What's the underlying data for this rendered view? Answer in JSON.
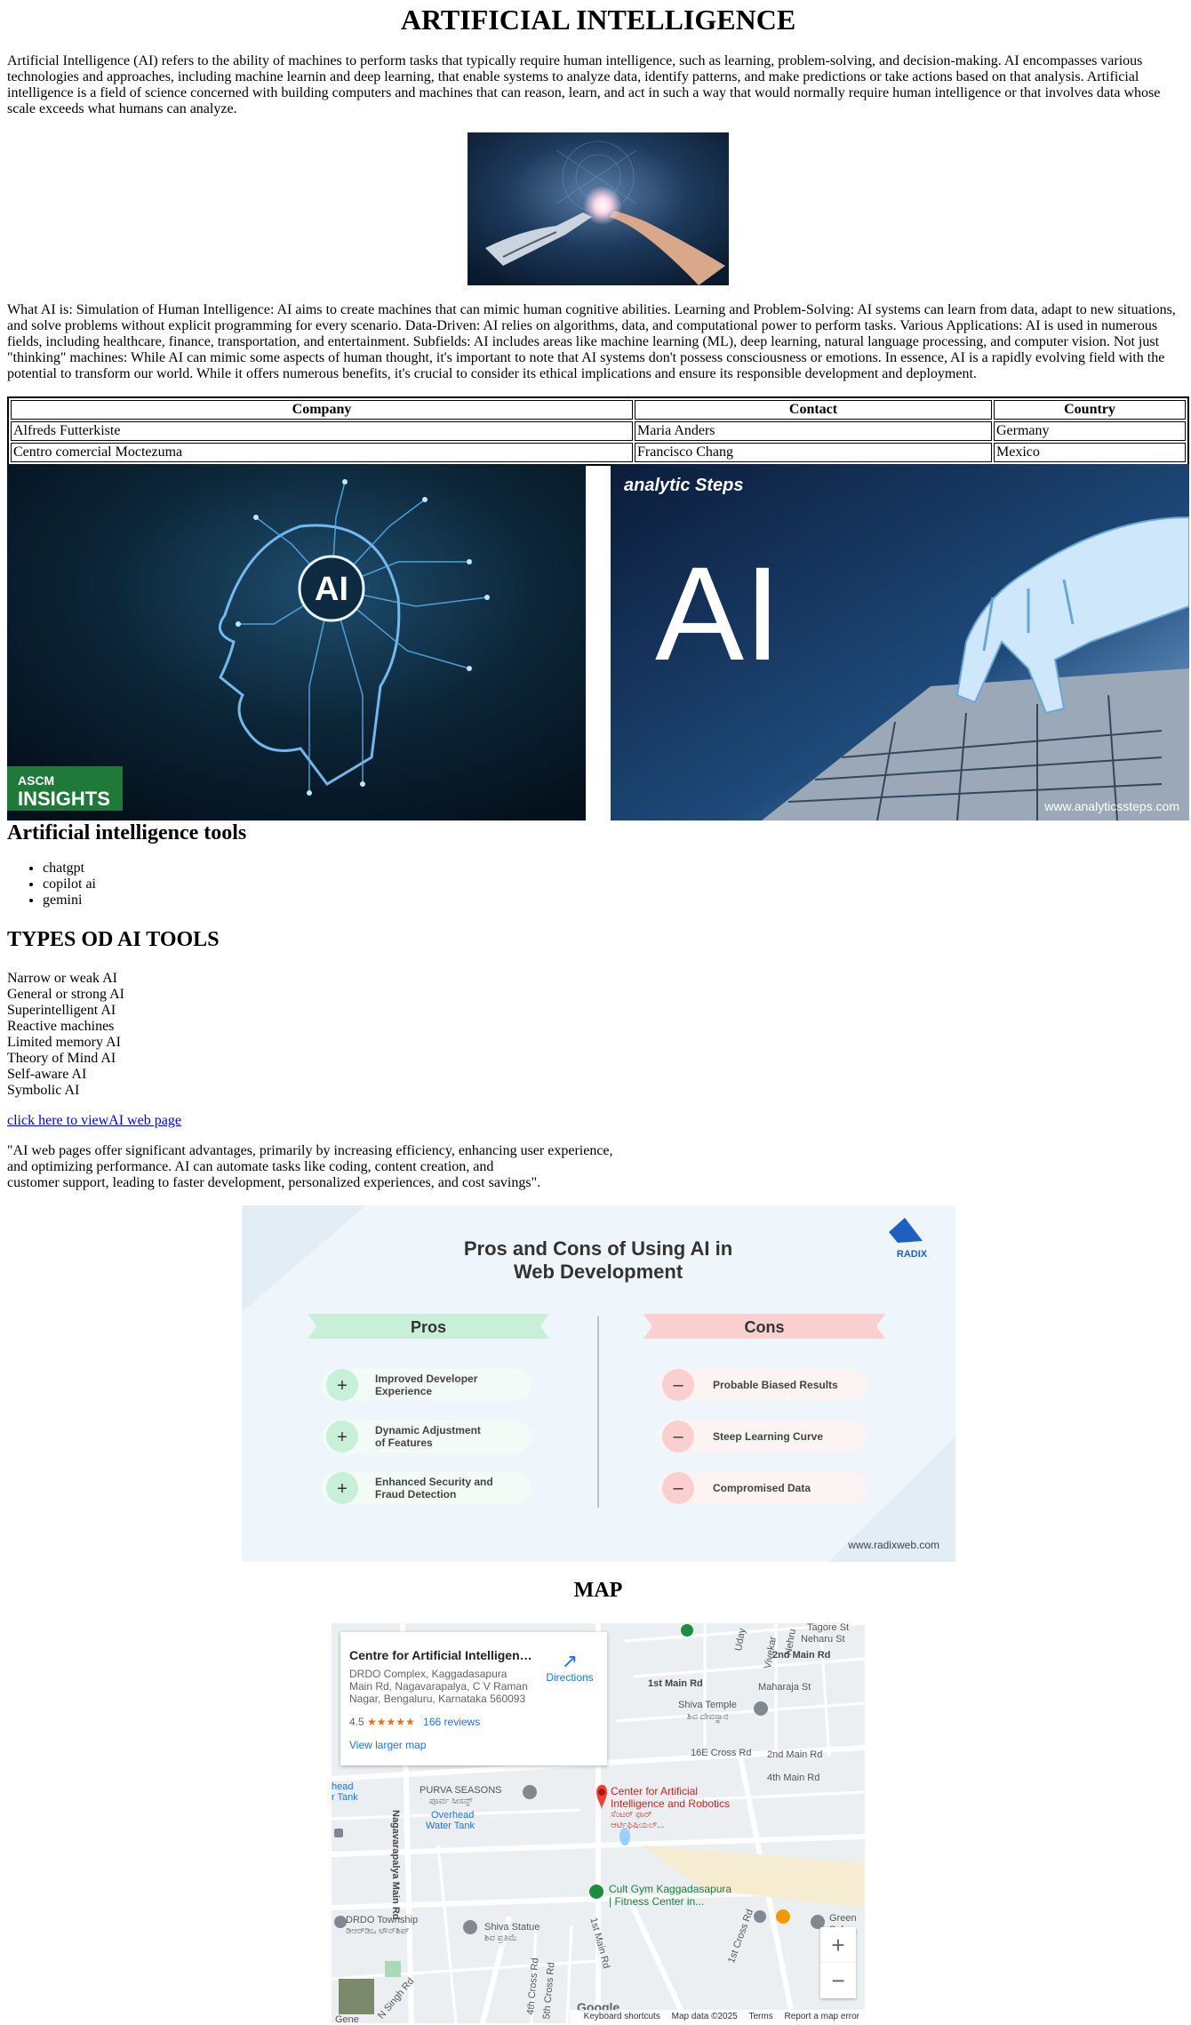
{
  "title": "ARTIFICIAL INTELLIGENCE",
  "intro": "Artificial Intelligence (AI) refers to the ability of machines to perform tasks that typically require human intelligence, such as learning, problem-solving, and decision-making. AI encompasses various technologies and approaches, including machine learnin and deep learning, that enable systems to analyze data, identify patterns, and make predictions or take actions based on that analysis. Artificial intelligence is a field of science concerned with building computers and machines that can reason, learn, and act in such a way that would normally require human intelligence or that involves data whose scale exceeds what humans can analyze.",
  "what_is": "What AI is: Simulation of Human Intelligence: AI aims to create machines that can mimic human cognitive abilities. Learning and Problem-Solving: AI systems can learn from data, adapt to new situations, and solve problems without explicit programming for every scenario. Data-Driven: AI relies on algorithms, data, and computational power to perform tasks. Various Applications: AI is used in numerous fields, including healthcare, finance, transportation, and entertainment. Subfields: AI includes areas like machine learning (ML), deep learning, natural language processing, and computer vision. Not just \"thinking\" machines: While AI can mimic some aspects of human thought, it's important to note that AI systems don't possess consciousness or emotions. In essence, AI is a rapidly evolving field with the potential to transform our world. While it offers numerous benefits, it's crucial to consider its ethical implications and ensure its responsible development and deployment.",
  "table": {
    "headers": [
      "Company",
      "Contact",
      "Country"
    ],
    "rows": [
      [
        "Alfreds Futterkiste",
        "Maria Anders",
        "Germany"
      ],
      [
        "Centro comercial Moctezuma",
        "Francisco Chang",
        "Mexico"
      ]
    ]
  },
  "banners": {
    "left_badge_line1": "ASCM",
    "left_badge_line2": "INSIGHTS",
    "left_center_text": "AI",
    "right_brand": "analytic Steps",
    "right_big_text": "AI",
    "right_url": "www.analyticssteps.com"
  },
  "tools_heading": "Artificial intelligence tools",
  "tools": [
    "chatgpt",
    "copilot ai",
    "gemini"
  ],
  "types_heading": "TYPES OD AI TOOLS",
  "types": [
    "Narrow or weak AI",
    "General or strong AI",
    "Superintelligent AI",
    "Reactive machines",
    "Limited memory AI",
    "Theory of Mind AI",
    "Self-aware AI",
    "Symbolic AI"
  ],
  "link_text": "click here to viewAI web page",
  "quote_lines": [
    "\"AI web pages offer significant advantages, primarily by increasing efficiency, enhancing user experience,",
    "and optimizing performance. AI can automate tasks like coding, content creation, and",
    "customer support, leading to faster development, personalized experiences, and cost savings\"."
  ],
  "proscons": {
    "title_line1": "Pros and Cons of Using AI in",
    "title_line2": "Web Development",
    "brand": "RADIX",
    "pros_label": "Pros",
    "cons_label": "Cons",
    "pros": [
      [
        "Improved Developer",
        "Experience"
      ],
      [
        "Dynamic Adjustment",
        "of Features"
      ],
      [
        "Enhanced Security and",
        "Fraud Detection"
      ]
    ],
    "cons": [
      "Probable Biased Results",
      "Steep Learning Curve",
      "Compromised Data"
    ],
    "url": "www.radixweb.com",
    "colors": {
      "pros": "#c8f0d9",
      "cons": "#f9cfcf",
      "title": "#333333"
    }
  },
  "map_heading": "MAP",
  "map": {
    "place_name": "Centre for Artificial Intelligence and Robotics",
    "address": "DRDO Complex, Kaggadasapura Main Rd, Nagavarapalya, C V Raman Nagar, Bengaluru, Karnataka 560093",
    "rating": "4.5",
    "stars": "★★★★★",
    "reviews": "166 reviews",
    "larger_map": "View larger map",
    "directions": "Directions",
    "zoom_in": "+",
    "zoom_out": "−",
    "footer": [
      "Keyboard shortcuts",
      "Map data ©2025",
      "Terms",
      "Report a map error"
    ],
    "google": "Google",
    "labels": {
      "first_main": "1st Main Rd",
      "shiva_temple": "Shiva Temple",
      "shiva_temple_kn": "ಶಿವ ದೇವಸ್ಥಾನ",
      "cross16": "16E Cross Rd",
      "main2": "2nd Main Rd",
      "main4": "4th Main Rd",
      "purva": "PURVA SEASONS",
      "purva_kn": "ಪೂರ್ವ ಸೀಸನ್ಸ್",
      "overhead": "Overhead",
      "water_tank": "Water Tank",
      "head": "head",
      "tank": "r Tank",
      "nag_main": "Nagavarapalya Main Rd",
      "center": "Center for Artificial",
      "center2": "Intelligence and Robotics",
      "center_kn": "ಸೆಂಟರ್ ಫಾರ್",
      "center_kn2": "ಆರ್ಟಿಫಿಷಿಯಲ್...",
      "cult": "Cult Gym Kaggadasapura",
      "cult2": "| Fitness Center in...",
      "drdo": "DRDO Township",
      "drdo_kn": "ಡಿಆರ್‌ಡಿಒ ಟೌನ್‌ಶಿಪ್",
      "statue": "Shiva Statue",
      "statue_kn": "ಶಿವ ಪ್ರತಿಮೆ",
      "first_main2": "1st Main Rd",
      "cross5": "5th Cross Rd",
      "cross4": "4th Cross Rd",
      "cross1": "1st Cross Rd",
      "nsingh": "N Singh Rd",
      "second_main": "2nd Main Rd",
      "maharaja": "Maharaja St",
      "neharu": "Neharu St",
      "tagore": "Tagore St",
      "uday": "Uday",
      "vivekar": "Vivekar",
      "nehru": "Nehru",
      "green": "Green",
      "salon": "Salon,",
      "gene": "Gene"
    }
  }
}
